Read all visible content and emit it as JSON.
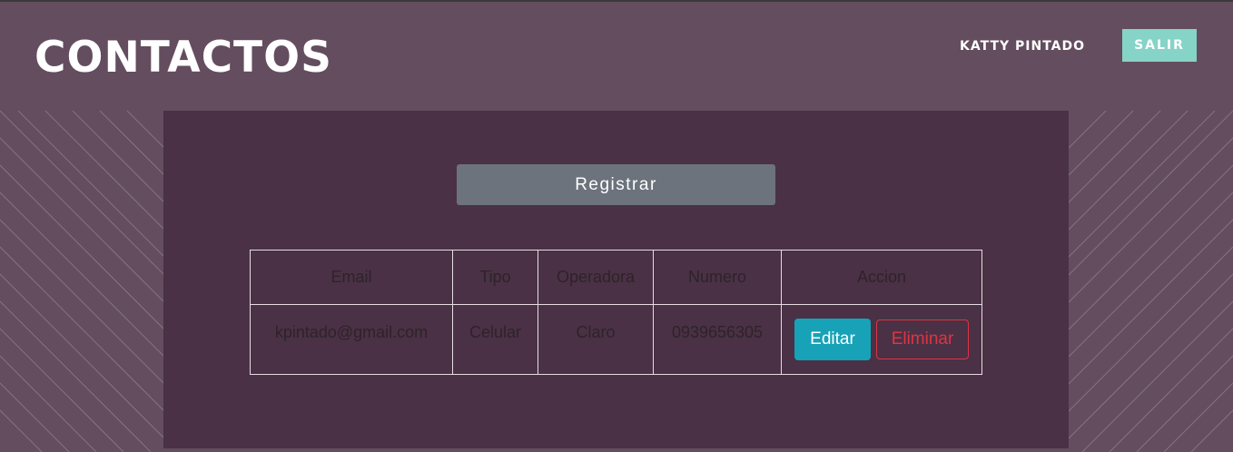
{
  "header": {
    "title": "CONTACTOS",
    "user_name": "KATTY PINTADO",
    "logout_label": "SALIR"
  },
  "main": {
    "register_label": "Registrar",
    "table": {
      "headers": [
        "Email",
        "Tipo",
        "Operadora",
        "Numero",
        "Accion"
      ],
      "rows": [
        {
          "email": "kpintado@gmail.com",
          "tipo": "Celular",
          "operadora": "Claro",
          "numero": "0939656305",
          "edit_label": "Editar",
          "delete_label": "Eliminar"
        }
      ]
    }
  },
  "colors": {
    "background": "#634d5e",
    "panel": "#4a3145",
    "logout_button": "#86d3c7",
    "register_button": "#6c737d",
    "edit_button": "#17a2b8",
    "delete_button": "#dc3545"
  }
}
